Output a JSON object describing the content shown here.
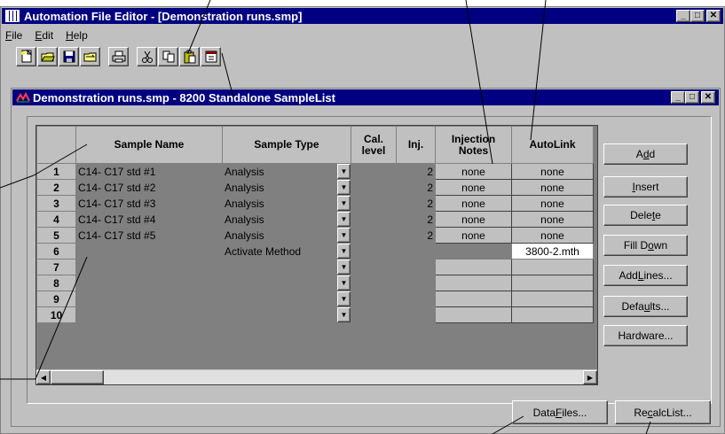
{
  "app": {
    "title": "Automation File Editor - [Demonstration runs.smp]",
    "menu": [
      "File",
      "Edit",
      "Help"
    ]
  },
  "toolbar": {
    "icons": [
      "new-file-icon",
      "open-folder-icon",
      "save-icon",
      "open-method-icon",
      "print-icon",
      "cut-icon",
      "copy-icon",
      "paste-icon",
      "properties-icon"
    ]
  },
  "child": {
    "title": "Demonstration runs.smp - 8200 Standalone SampleList"
  },
  "grid": {
    "columns": [
      "Sample Name",
      "Sample Type",
      "Cal. level",
      "Inj.",
      "Injection Notes",
      "AutoLink"
    ],
    "rows": [
      {
        "num": "1",
        "name": "C14- C17 std #1",
        "type": "Analysis",
        "inj": "2",
        "notes": "none",
        "autolink": "none"
      },
      {
        "num": "2",
        "name": "C14- C17 std #2",
        "type": "Analysis",
        "inj": "2",
        "notes": "none",
        "autolink": "none"
      },
      {
        "num": "3",
        "name": "C14- C17 std #3",
        "type": "Analysis",
        "inj": "2",
        "notes": "none",
        "autolink": "none"
      },
      {
        "num": "4",
        "name": "C14- C17 std #4",
        "type": "Analysis",
        "inj": "2",
        "notes": "none",
        "autolink": "none"
      },
      {
        "num": "5",
        "name": "C14- C17 std #5",
        "type": "Analysis",
        "inj": "2",
        "notes": "none",
        "autolink": "none"
      },
      {
        "num": "6",
        "name": "",
        "type": "Activate Method",
        "inj": "",
        "notes": "",
        "autolink": "3800-2.mth"
      },
      {
        "num": "7",
        "name": "",
        "type": "",
        "inj": "",
        "notes": "",
        "autolink": ""
      },
      {
        "num": "8",
        "name": "",
        "type": "",
        "inj": "",
        "notes": "",
        "autolink": ""
      },
      {
        "num": "9",
        "name": "",
        "type": "",
        "inj": "",
        "notes": "",
        "autolink": ""
      },
      {
        "num": "10",
        "name": "",
        "type": "",
        "inj": "",
        "notes": "",
        "autolink": ""
      }
    ]
  },
  "side_buttons": {
    "add": "Add",
    "insert": "Insert",
    "delete": "Delete",
    "fill_down": "Fill Down",
    "add_lines": "Add Lines...",
    "defaults": "Defaults...",
    "hardware": "Hardware..."
  },
  "bottom_buttons": {
    "data_files": "Data Files...",
    "recalc_list": "RecalcList..."
  },
  "colors": {
    "titlebar": "#000080",
    "face": "#c0c0c0",
    "shadow": "#808080"
  }
}
